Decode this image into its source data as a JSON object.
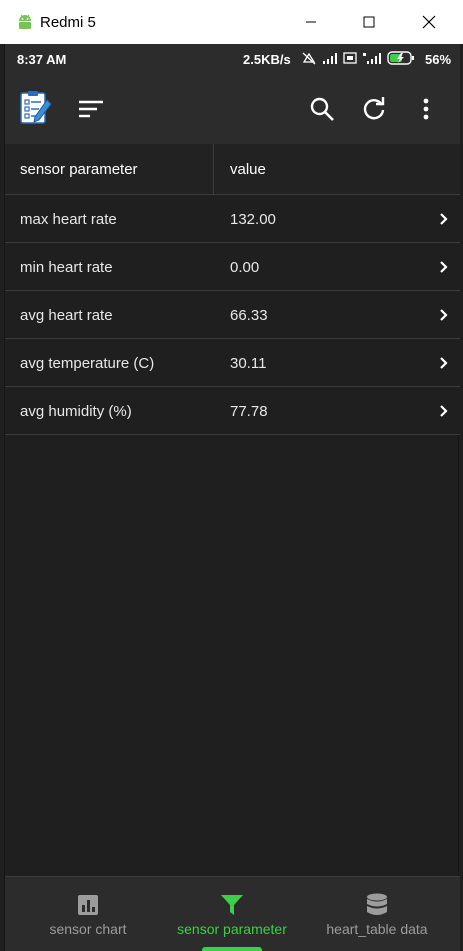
{
  "window": {
    "title": "Redmi 5"
  },
  "statusbar": {
    "time": "8:37 AM",
    "net_speed": "2.5KB/s",
    "battery": "56%"
  },
  "appbar": {
    "logo_icon": "checklist-icon",
    "sort_icon": "sort-icon",
    "search_icon": "search-icon",
    "refresh_icon": "refresh-icon",
    "menu_icon": "more-vert-icon"
  },
  "table": {
    "headers": [
      "sensor parameter",
      "value"
    ],
    "rows": [
      {
        "param": "max heart rate",
        "value": "132.00"
      },
      {
        "param": "min heart rate",
        "value": "0.00"
      },
      {
        "param": "avg heart rate",
        "value": "66.33"
      },
      {
        "param": "avg temperature (C)",
        "value": "30.11"
      },
      {
        "param": "avg humidity (%)",
        "value": "77.78"
      }
    ]
  },
  "bottomnav": {
    "items": [
      {
        "label": "sensor chart",
        "icon": "bar-chart-icon",
        "active": false
      },
      {
        "label": "sensor parameter",
        "icon": "filter-icon",
        "active": true
      },
      {
        "label": "heart_table data",
        "icon": "database-icon",
        "active": false
      }
    ]
  },
  "colors": {
    "background": "#1e1f1e",
    "bar": "#2b2c2b",
    "accent": "#3ecf4a",
    "text": "#e8e8e8"
  }
}
